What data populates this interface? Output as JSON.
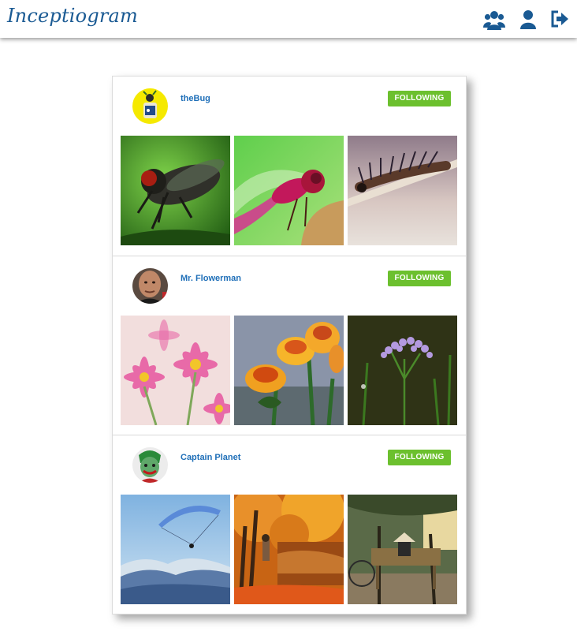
{
  "app": {
    "name": "Inceptiogram"
  },
  "nav": {
    "icons": [
      "users-icon",
      "user-icon",
      "sign-out-icon"
    ]
  },
  "posts": [
    {
      "username": "theBug",
      "follow_label": "FOLLOWING",
      "photos": [
        "fly-photo",
        "dragonfly-photo",
        "caterpillar-photo"
      ]
    },
    {
      "username": "Mr. Flowerman",
      "follow_label": "FOLLOWING",
      "photos": [
        "pink-daisies-photo",
        "orange-roses-photo",
        "purple-wildflower-photo"
      ]
    },
    {
      "username": "Captain Planet",
      "follow_label": "FOLLOWING",
      "photos": [
        "paraglider-photo",
        "autumn-park-photo",
        "bench-photo"
      ]
    }
  ],
  "colors": {
    "brand": "#1a5a93",
    "link": "#1f6fb8",
    "following": "#6cc02e"
  }
}
